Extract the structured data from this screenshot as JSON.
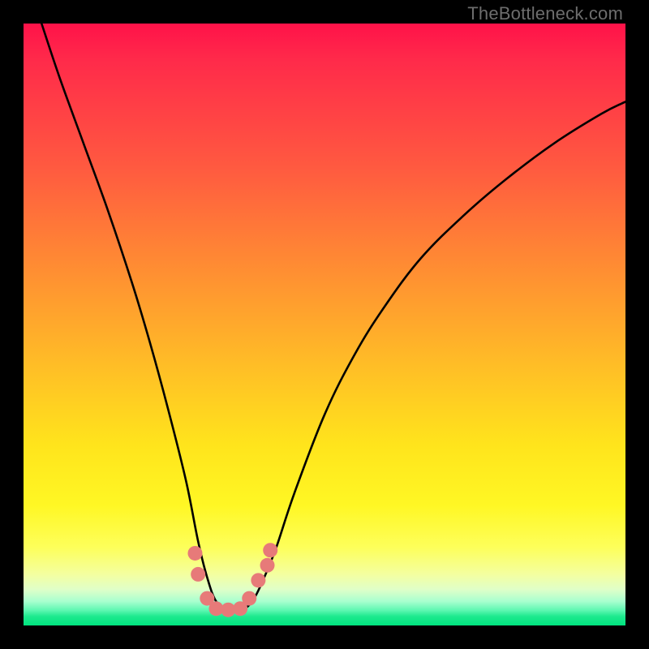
{
  "watermark": "TheBottleneck.com",
  "chart_data": {
    "type": "line",
    "title": "",
    "xlabel": "",
    "ylabel": "",
    "xlim": [
      0,
      100
    ],
    "ylim": [
      0,
      100
    ],
    "series": [
      {
        "name": "bottleneck-curve",
        "x": [
          3,
          6,
          10,
          14,
          18,
          21,
          24,
          27,
          29,
          30.5,
          32,
          34,
          36,
          38,
          40,
          42,
          45,
          50,
          55,
          60,
          66,
          73,
          80,
          88,
          96,
          100
        ],
        "values": [
          100,
          91,
          80,
          69,
          57,
          47,
          36,
          24,
          14,
          8,
          4,
          2.5,
          2.5,
          4,
          8,
          13,
          22,
          35,
          45,
          53,
          61,
          68,
          74,
          80,
          85,
          87
        ]
      }
    ],
    "markers": {
      "name": "highlight-points",
      "color": "#e77a79",
      "x": [
        28.5,
        29.0,
        30.5,
        32.0,
        34.0,
        36.0,
        37.5,
        39.0,
        40.5,
        41.0
      ],
      "values": [
        12.0,
        8.5,
        4.5,
        2.8,
        2.6,
        2.8,
        4.5,
        7.5,
        10.0,
        12.5
      ]
    },
    "gradient_bg": true,
    "grid": false,
    "legend": false
  }
}
